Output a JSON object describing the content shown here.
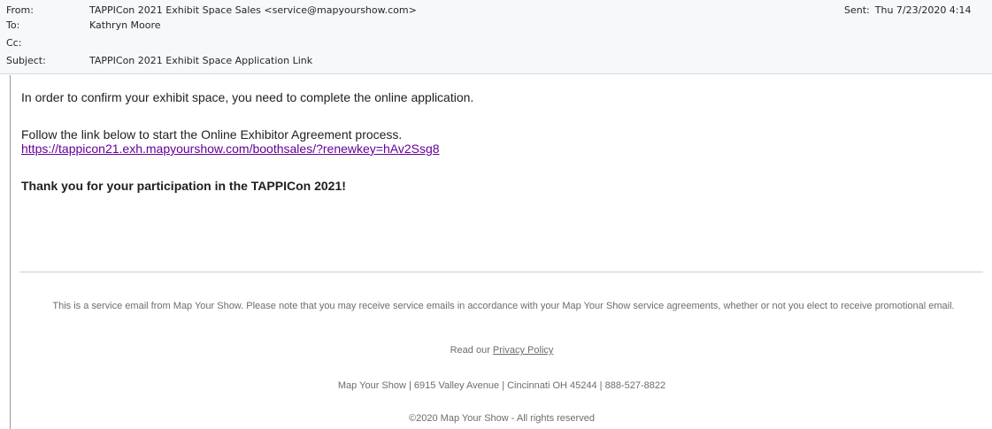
{
  "header": {
    "from_label": "From:",
    "from_value": "TAPPICon 2021 Exhibit Space Sales <service@mapyourshow.com>",
    "to_label": "To:",
    "to_value": "Kathryn Moore",
    "cc_label": "Cc:",
    "cc_value": "",
    "subject_label": "Subject:",
    "subject_value": "TAPPICon 2021 Exhibit Space Application Link",
    "sent_label": "Sent:",
    "sent_value": "Thu 7/23/2020 4:14"
  },
  "message": {
    "line1": "In order to confirm your exhibit space, you need to complete the online application.",
    "line2": "Follow the link below to start the Online Exhibitor Agreement process.",
    "link": "https://tappicon21.exh.mapyourshow.com/boothsales/?renewkey=hAv2Ssg8",
    "thanks": "Thank you for your participation in the TAPPICon 2021!"
  },
  "footer": {
    "service_notice": "This is a service email from Map Your Show. Please note that you may receive service emails in accordance with your Map Your Show service agreements, whether or not you elect to receive promotional email.",
    "read_our": "Read our ",
    "privacy_link": "Privacy Policy",
    "address": "Map Your Show | 6915 Valley Avenue | Cincinnati OH 45244 | 888-527-8822",
    "copyright": "©2020 Map Your Show - All rights reserved"
  },
  "colors": {
    "header_bg": "#f7f8fa",
    "visited_link": "#660099",
    "footer_text": "#6d6d6d"
  }
}
